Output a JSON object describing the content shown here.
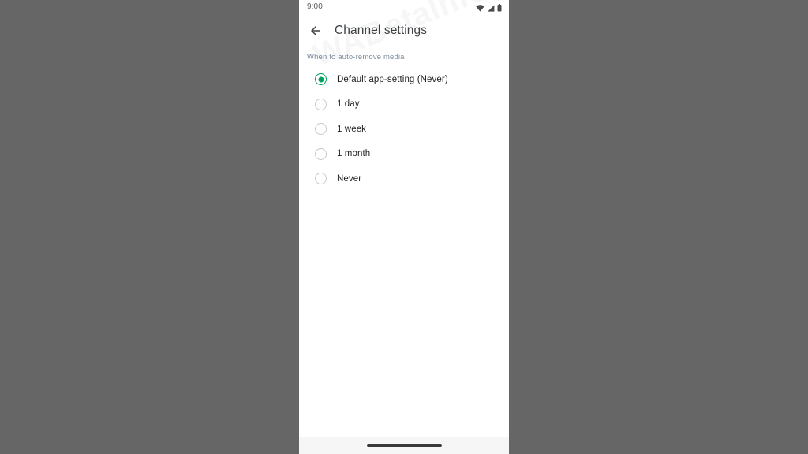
{
  "theme": {
    "backdrop_color": "#666666",
    "phone_background": "#ffffff",
    "accent_color": "#00a060",
    "radio_unselected_color": "#c4cacd",
    "title_color": "#3c4043",
    "section_header_color": "#7d8c9e",
    "label_color": "#1f1f1f",
    "nav_bar_color": "#f6f6f6",
    "gesture_pill_color": "#3a3a3a"
  },
  "status_bar": {
    "clock": "9:00",
    "icons": [
      {
        "name": "wifi-icon"
      },
      {
        "name": "cellular-signal-icon"
      },
      {
        "name": "battery-icon"
      }
    ]
  },
  "app_bar": {
    "back_icon": "back-arrow-icon",
    "title": "Channel settings"
  },
  "section": {
    "header": "When to auto-remove media"
  },
  "radio_group": {
    "selected_index": 0,
    "options": [
      {
        "label": "Default app-setting (Never)",
        "selected": true
      },
      {
        "label": "1 day",
        "selected": false
      },
      {
        "label": "1 week",
        "selected": false
      },
      {
        "label": "1 month",
        "selected": false
      },
      {
        "label": "Never",
        "selected": false
      }
    ]
  },
  "watermark": {
    "text": "WABetaInfo"
  },
  "nav_bar": {
    "gesture_pill": "gesture-home-pill"
  }
}
